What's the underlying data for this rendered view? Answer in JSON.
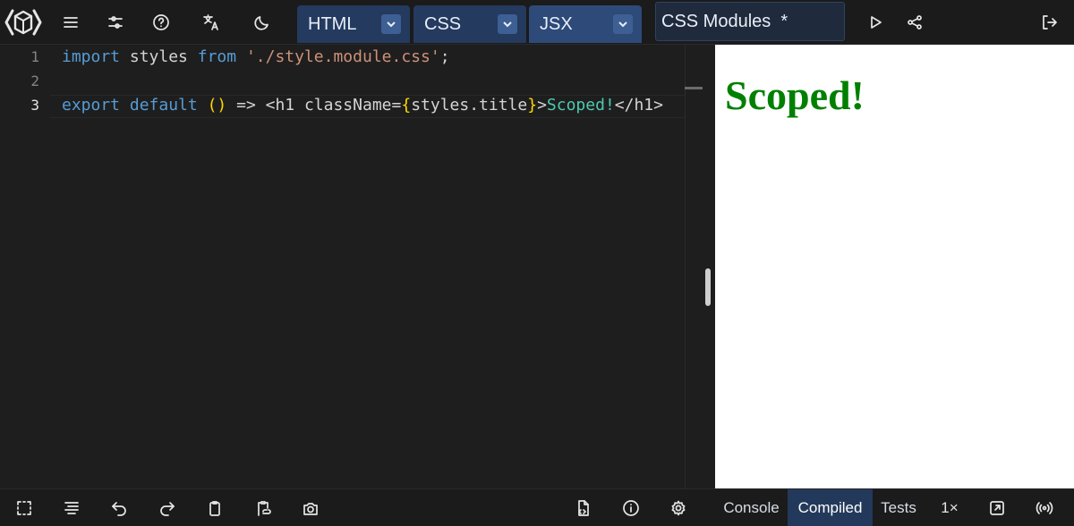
{
  "toolbar": {
    "editors": [
      {
        "label": "HTML"
      },
      {
        "label": "CSS"
      },
      {
        "label": "JSX"
      }
    ],
    "project_title": "CSS Modules  *"
  },
  "editor": {
    "line_numbers": [
      "1",
      "2",
      "3"
    ],
    "line1": {
      "kw_import": "import",
      "ident": " styles ",
      "kw_from": "from",
      "sp": " ",
      "str": "'./style.module.css'",
      "semi": ";"
    },
    "line3": {
      "kw_export": "export",
      "sp1": " ",
      "kw_default": "default",
      "sp2": " ",
      "paren": "()",
      "arrow": " => <h1 className=",
      "brace_open": "{",
      "expr": "styles.title",
      "brace_close": "}",
      "gt": ">",
      "text": "Scoped!",
      "close_tag": "</h1>"
    }
  },
  "result": {
    "heading": "Scoped!"
  },
  "bottom": {
    "tool_tabs": [
      {
        "label": "Console"
      },
      {
        "label": "Compiled"
      },
      {
        "label": "Tests"
      }
    ],
    "zoom": "1×"
  },
  "colors": {
    "accent": "#2d4a78",
    "result_heading": "#008000"
  }
}
